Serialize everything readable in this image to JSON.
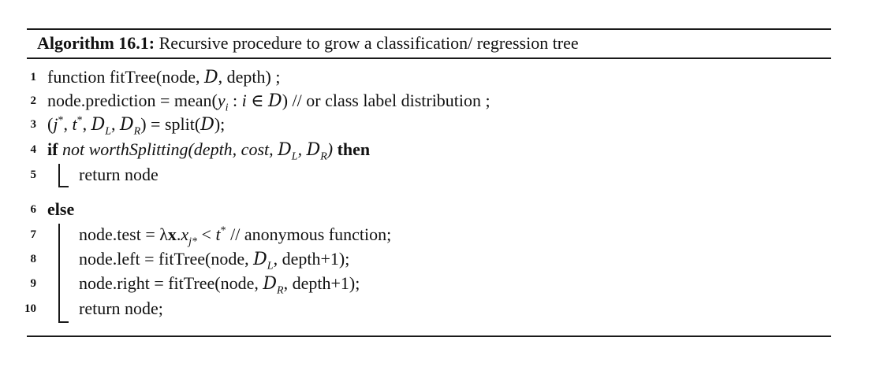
{
  "caption": {
    "label": "Algorithm 16.1:",
    "text": " Recursive procedure to grow a classification/ regression tree"
  },
  "lines": [
    {
      "num": "1",
      "parts": [
        "function fitTree(node, ",
        "D",
        ", depth) ;"
      ]
    },
    {
      "num": "2",
      "parts": [
        "node.prediction = mean(",
        "y",
        "i",
        " : ",
        "i",
        " ∈ ",
        "D",
        ") // or class label distribution ;"
      ]
    },
    {
      "num": "3",
      "parts": [
        "(",
        "j",
        "*",
        ", ",
        "t",
        "*",
        ", ",
        "D",
        "L",
        ", ",
        "D",
        "R",
        ") = split(",
        "D",
        ");"
      ]
    },
    {
      "num": "4",
      "parts": [
        "if",
        " not worthSplitting(depth, cost, ",
        "D",
        "L",
        ", ",
        "D",
        "R",
        ")",
        " then"
      ]
    },
    {
      "num": "5",
      "parts": [
        "return node"
      ]
    },
    {
      "num": "6",
      "parts": [
        "else"
      ]
    },
    {
      "num": "7",
      "parts": [
        "node.test = λ",
        "x",
        ".",
        "x",
        "j*",
        " < ",
        "t",
        "*",
        " // anonymous function;"
      ]
    },
    {
      "num": "8",
      "parts": [
        "node.left = fitTree(node, ",
        "D",
        "L",
        ", depth+1);"
      ]
    },
    {
      "num": "9",
      "parts": [
        "node.right = fitTree(node, ",
        "D",
        "R",
        ", depth+1);"
      ]
    },
    {
      "num": "10",
      "parts": [
        "return node;"
      ]
    }
  ]
}
